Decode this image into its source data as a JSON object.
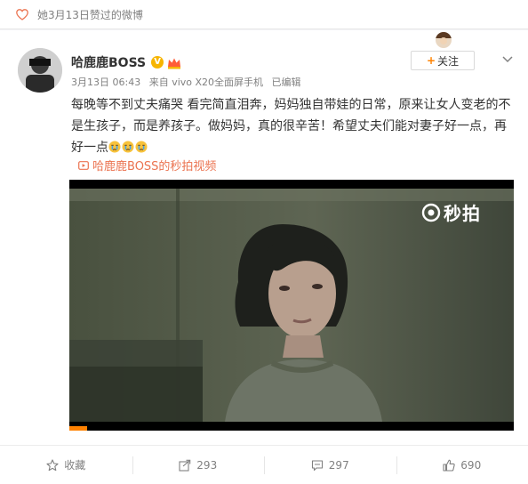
{
  "liked_bar": {
    "text": "她3月13日赞过的微博",
    "icon": "heart-outline-icon"
  },
  "author": {
    "name": "哈鹿鹿BOSS",
    "badges": [
      "vip-v-badge-icon",
      "crown-badge-icon"
    ],
    "date": "3月13日 06:43",
    "source": "来自 vivo X20全面屏手机",
    "edited": "已编辑"
  },
  "follow": {
    "plus": "+",
    "label": "关注"
  },
  "post": {
    "text": "每晚等不到丈夫痛哭 看完简直泪奔，妈妈独自带娃的日常，原来让女人变老的不是生孩子，而是养孩子。做妈妈，真的很辛苦！希望丈夫们能对妻子好一点，再好一点",
    "emoji_count": 3,
    "emoji_name": "crying-emoji-icon"
  },
  "video": {
    "link_text": "哈鹿鹿BOSS的秒拍视频",
    "watermark": "秒拍",
    "progress_fraction": 0.04
  },
  "actions": [
    {
      "label": "收藏",
      "icon": "star-icon"
    },
    {
      "label": "293",
      "icon": "share-icon"
    },
    {
      "label": "297",
      "icon": "comment-icon"
    },
    {
      "label": "690",
      "icon": "thumbs-up-icon"
    }
  ],
  "colors": {
    "accent": "#ff8200",
    "link": "#eb7350",
    "muted": "#808080",
    "badge": "#f7b500"
  }
}
